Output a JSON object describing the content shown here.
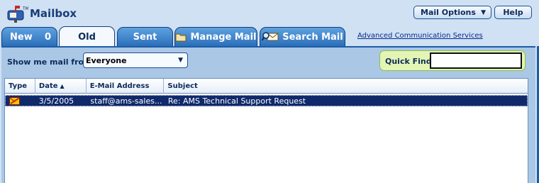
{
  "header": {
    "app_title": "Mailbox",
    "mail_options_label": "Mail Options",
    "help_label": "Help"
  },
  "tabs": [
    {
      "label": "New",
      "count": "0"
    },
    {
      "label": "Old",
      "active": true
    },
    {
      "label": "Sent"
    },
    {
      "label": "Manage Mail",
      "icon": "folder-icon"
    },
    {
      "label": "Search Mail",
      "icon": "search-mail-icon"
    }
  ],
  "links": {
    "ams": "Advanced Communication Services"
  },
  "filter": {
    "label": "Show me mail from:",
    "selected": "Everyone"
  },
  "quick_find": {
    "label": "Quick Find:",
    "value": ""
  },
  "table": {
    "columns": [
      "Type",
      "Date",
      "E-Mail Address",
      "Subject"
    ],
    "sort_column": "Date",
    "rows": [
      {
        "type_icon": "read-mail-icon",
        "date": "3/5/2005",
        "email": "staff@ams-sales...",
        "subject": "Re: AMS Technical Support Request",
        "selected": true
      }
    ]
  },
  "colors": {
    "background": "#cfe1f3",
    "tab_blue": "#2c6fba",
    "selected_row": "#10296b",
    "quick_find_green": "#e2f5b4"
  }
}
